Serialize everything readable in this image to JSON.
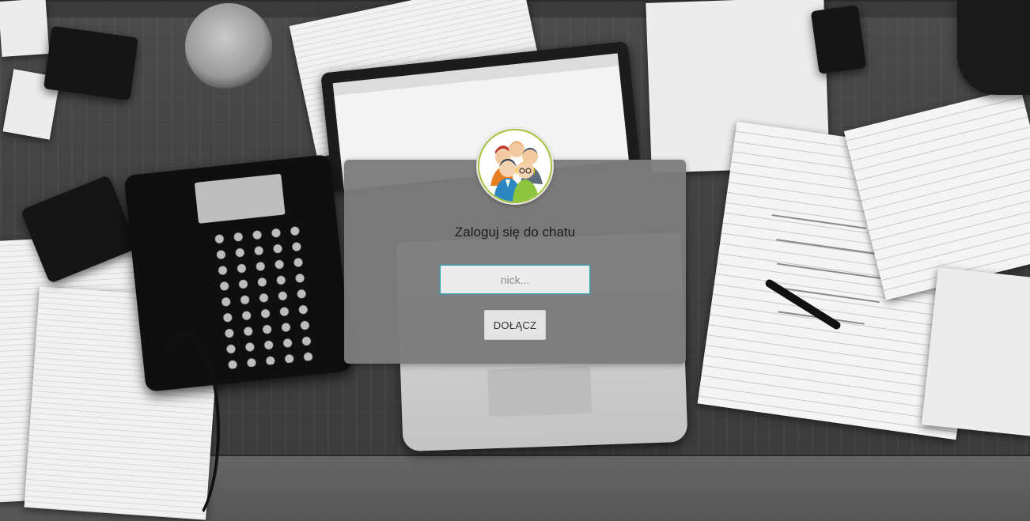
{
  "login": {
    "title": "Zaloguj się do chatu",
    "nick_placeholder": "nick...",
    "nick_value": "",
    "join_label": "DOŁĄCZ"
  },
  "avatar": {
    "icon": "group-of-people-icon",
    "colors": {
      "ring": "#a5c23a",
      "person_green": "#8cc63f",
      "person_blue": "#2e86c1",
      "person_orange": "#e67e22"
    }
  },
  "background": {
    "description_icon": "desk-photo-background"
  }
}
